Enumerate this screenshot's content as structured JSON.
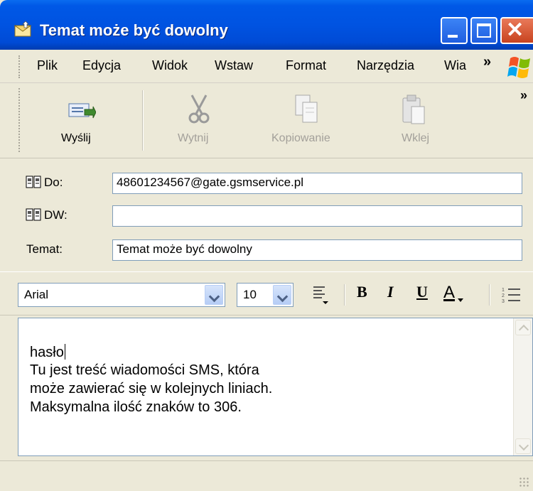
{
  "window": {
    "title": "Temat może być dowolny",
    "controls": {
      "minimize": "minimize",
      "maximize": "maximize",
      "close": "close"
    }
  },
  "menu": {
    "items": [
      "Plik",
      "Edycja",
      "Widok",
      "Wstaw",
      "Format",
      "Narzędzia",
      "Wia"
    ],
    "overflow": "»"
  },
  "toolbar": {
    "send": "Wyślij",
    "cut": "Wytnij",
    "copy": "Kopiowanie",
    "paste": "Wklej",
    "overflow": "»"
  },
  "fields": {
    "to_label": "Do:",
    "to_value": "48601234567@gate.gsmservice.pl",
    "cc_label": "DW:",
    "cc_value": "",
    "subject_label": "Temat:",
    "subject_value": "Temat może być dowolny"
  },
  "format": {
    "font": "Arial",
    "size": "10",
    "bold": "B",
    "italic": "I",
    "underline": "U",
    "font_color": "A"
  },
  "body": {
    "lines": [
      "hasło",
      "Tu jest treść wiadomości SMS, która",
      "może zawierać się w kolejnych liniach.",
      "Maksymalna ilość znaków to 306."
    ]
  },
  "colors": {
    "titlebar": "#0053e1",
    "close_button": "#c8431f",
    "chrome": "#ece9d8",
    "input_border": "#7f9db9"
  }
}
